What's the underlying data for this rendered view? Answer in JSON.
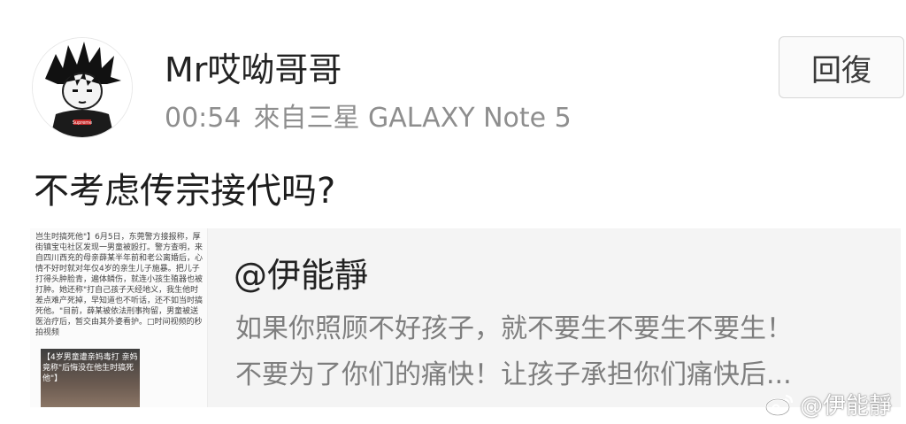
{
  "user": {
    "name": "Mr哎呦哥哥",
    "time": "00:54",
    "device": "來自三星 GALAXY Note 5",
    "avatar": "goku-avatar",
    "avatar_shirt_text": "Supreme"
  },
  "reply_button": {
    "label": "回復"
  },
  "comment": {
    "text": "不考虑传宗接代吗?"
  },
  "quoted_post": {
    "author": "@伊能靜",
    "line1": "如果你照顾不好孩子，就不要生不要生不要生！",
    "line2": "不要为了你们的痛快！让孩子承担你们痛快后...",
    "thumbnail": {
      "text": "岂生时搞死他\"】6月5日，东莞警方接报称，厚街镇宝屯社区发现一男童被殴打。警方查明，来自四川西充的母亲薛某半年前和老公离婚后，心情不好时就对年仅4岁的亲生儿子施暴。把儿子打得头肿脸青，遍体鳞伤，就连小孩生殖器也被打肿。她还称\"打自己孩子天经地义，我生他时差点难产死掉，早知道也不听话，还不如当时搞死他。\"目前，薛某被依法刑事拘留，男童被送医治疗后，暂交由其外婆看护。□时间视频的秒拍视频",
      "caption": "【4岁男童遭亲妈毒打 亲妈竟称\"后悔没在他生时搞死他\"】"
    }
  },
  "watermark": {
    "text": "@伊能靜",
    "icon": "weibo-icon"
  }
}
